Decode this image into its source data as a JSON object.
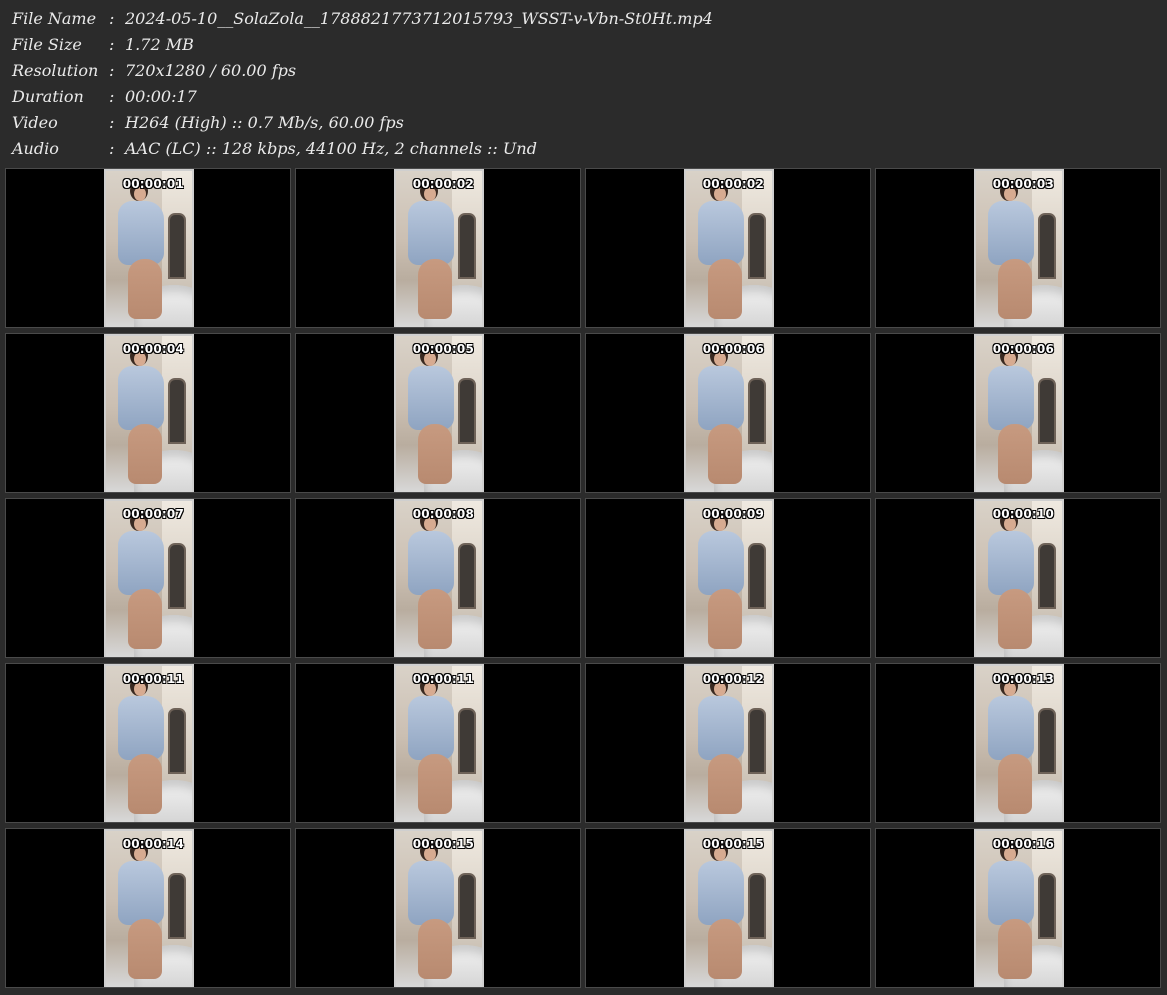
{
  "info": [
    {
      "label": "File Name",
      "value": "2024-05-10__SolaZola__1788821773712015793_WSST-v-Vbn-St0Ht.mp4"
    },
    {
      "label": "File Size",
      "value": "1.72 MB"
    },
    {
      "label": "Resolution",
      "value": "720x1280 / 60.00 fps"
    },
    {
      "label": "Duration",
      "value": "00:00:17"
    },
    {
      "label": "Video",
      "value": "H264 (High) :: 0.7 Mb/s, 60.00 fps"
    },
    {
      "label": "Audio",
      "value": "AAC (LC) :: 128 kbps, 44100 Hz, 2 channels :: Und"
    }
  ],
  "separator": ":",
  "thumbnails": [
    {
      "timestamp": "00:00:01"
    },
    {
      "timestamp": "00:00:02"
    },
    {
      "timestamp": "00:00:02"
    },
    {
      "timestamp": "00:00:03"
    },
    {
      "timestamp": "00:00:04"
    },
    {
      "timestamp": "00:00:05"
    },
    {
      "timestamp": "00:00:06"
    },
    {
      "timestamp": "00:00:06"
    },
    {
      "timestamp": "00:00:07"
    },
    {
      "timestamp": "00:00:08"
    },
    {
      "timestamp": "00:00:09"
    },
    {
      "timestamp": "00:00:10"
    },
    {
      "timestamp": "00:00:11"
    },
    {
      "timestamp": "00:00:11"
    },
    {
      "timestamp": "00:00:12"
    },
    {
      "timestamp": "00:00:13"
    },
    {
      "timestamp": "00:00:14"
    },
    {
      "timestamp": "00:00:15"
    },
    {
      "timestamp": "00:00:15"
    },
    {
      "timestamp": "00:00:16"
    }
  ]
}
